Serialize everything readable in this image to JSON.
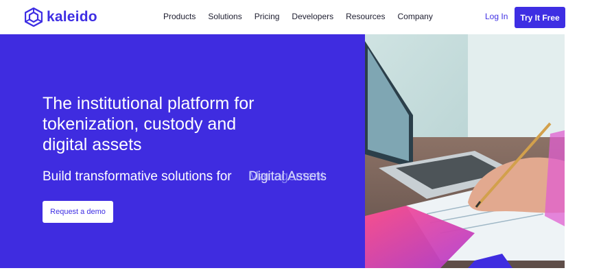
{
  "brand": {
    "name": "kaleido",
    "logo_icon": "hexagon-cube-icon",
    "accent": "#3e2ee3"
  },
  "nav": {
    "items": [
      "Products",
      "Solutions",
      "Pricing",
      "Developers",
      "Resources",
      "Company"
    ],
    "login_label": "Log In",
    "cta_label": "Try It Free"
  },
  "hero": {
    "background": "#3f2ce0",
    "title": "The institutional platform for tokenization, custody and digital assets",
    "subtitle_lead": "Build transformative solutions for",
    "subtitle_rotating": [
      "Digital Assets",
      "Management"
    ],
    "demo_label": "Request a demo",
    "photo": "laptop-and-hand-writing-image"
  }
}
